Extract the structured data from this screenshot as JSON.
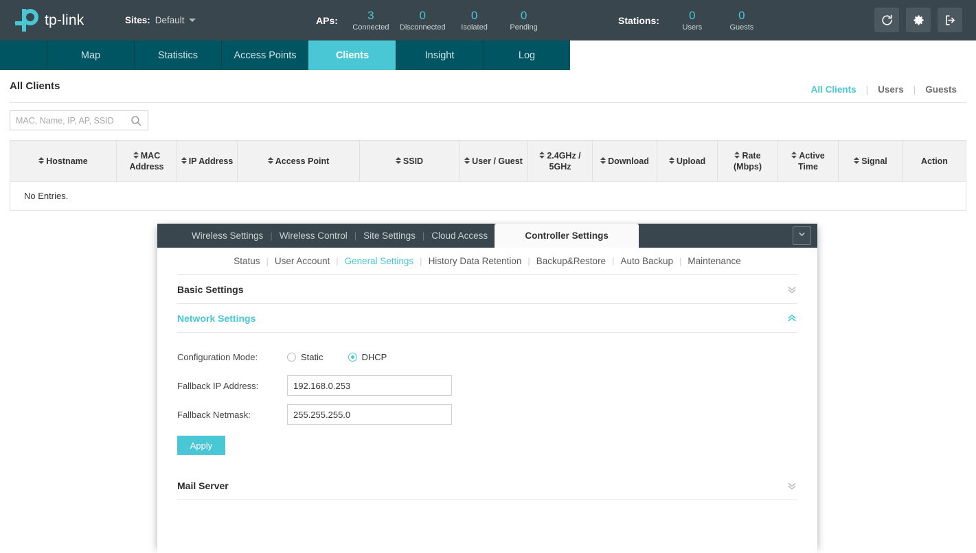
{
  "header": {
    "logo_text": "tp-link",
    "sites_label": "Sites:",
    "sites_value": "Default",
    "aps_label": "APs:",
    "stations_label": "Stations:",
    "ap_stats": [
      {
        "value": "3",
        "label": "Connected"
      },
      {
        "value": "0",
        "label": "Disconnected"
      },
      {
        "value": "0",
        "label": "Isolated"
      },
      {
        "value": "0",
        "label": "Pending"
      }
    ],
    "station_stats": [
      {
        "value": "0",
        "label": "Users"
      },
      {
        "value": "0",
        "label": "Guests"
      }
    ],
    "icons": [
      {
        "name": "refresh-icon",
        "title": "Refresh"
      },
      {
        "name": "gear-icon",
        "title": "Settings"
      },
      {
        "name": "logout-icon",
        "title": "Log Out"
      }
    ],
    "accent_color": "#4ac7d4",
    "bar_color": "#39464e"
  },
  "mainnav": {
    "items": [
      {
        "label": "Map",
        "active": false
      },
      {
        "label": "Statistics",
        "active": false
      },
      {
        "label": "Access Points",
        "active": false
      },
      {
        "label": "Clients",
        "active": true
      },
      {
        "label": "Insight",
        "active": false
      },
      {
        "label": "Log",
        "active": false
      }
    ],
    "bar_color": "#005563",
    "active_color": "#4ac7d4"
  },
  "content": {
    "page_title": "All Clients",
    "view_switch": [
      {
        "label": "All Clients",
        "active": true
      },
      {
        "label": "Users",
        "active": false
      },
      {
        "label": "Guests",
        "active": false
      }
    ],
    "search": {
      "placeholder": "MAC, Name, IP, AP, SSID",
      "value": ""
    },
    "table": {
      "columns": [
        {
          "label": "Hostname",
          "sortable": true
        },
        {
          "label": "MAC Address",
          "sortable": true
        },
        {
          "label": "IP Address",
          "sortable": true
        },
        {
          "label": "Access Point",
          "sortable": true
        },
        {
          "label": "SSID",
          "sortable": true
        },
        {
          "label": "User / Guest",
          "sortable": true
        },
        {
          "label": "2.4GHz / 5GHz",
          "sortable": true
        },
        {
          "label": "Download",
          "sortable": true
        },
        {
          "label": "Upload",
          "sortable": true
        },
        {
          "label": "Rate (Mbps)",
          "sortable": true
        },
        {
          "label": "Active Time",
          "sortable": true
        },
        {
          "label": "Signal",
          "sortable": true
        },
        {
          "label": "Action",
          "sortable": false
        }
      ],
      "rows": [],
      "empty_text": "No Entries."
    }
  },
  "panel": {
    "tabs": [
      {
        "label": "Wireless Settings",
        "active": false
      },
      {
        "label": "Wireless Control",
        "active": false
      },
      {
        "label": "Site Settings",
        "active": false
      },
      {
        "label": "Cloud Access",
        "active": false
      },
      {
        "label": "Controller Settings",
        "active": true
      }
    ],
    "dropdown_icon": "chevron-down-icon",
    "subtabs": [
      {
        "label": "Status",
        "active": false
      },
      {
        "label": "User Account",
        "active": false
      },
      {
        "label": "General Settings",
        "active": true
      },
      {
        "label": "History Data Retention",
        "active": false
      },
      {
        "label": "Backup&Restore",
        "active": false
      },
      {
        "label": "Auto Backup",
        "active": false
      },
      {
        "label": "Maintenance",
        "active": false
      }
    ],
    "sections": {
      "basic": {
        "title": "Basic Settings",
        "expanded": false,
        "chevron": "chevron-double-down-icon"
      },
      "network": {
        "title": "Network Settings",
        "expanded": true,
        "chevron": "chevron-double-up-icon"
      },
      "mail": {
        "title": "Mail Server",
        "expanded": false,
        "chevron": "chevron-double-down-icon"
      }
    },
    "form": {
      "config_mode_label": "Configuration Mode:",
      "config_mode_options": [
        {
          "label": "Static",
          "selected": false
        },
        {
          "label": "DHCP",
          "selected": true
        }
      ],
      "fallback_ip_label": "Fallback IP Address:",
      "fallback_ip_value": "192.168.0.253",
      "fallback_netmask_label": "Fallback Netmask:",
      "fallback_netmask_value": "255.255.255.0",
      "apply_label": "Apply"
    }
  }
}
